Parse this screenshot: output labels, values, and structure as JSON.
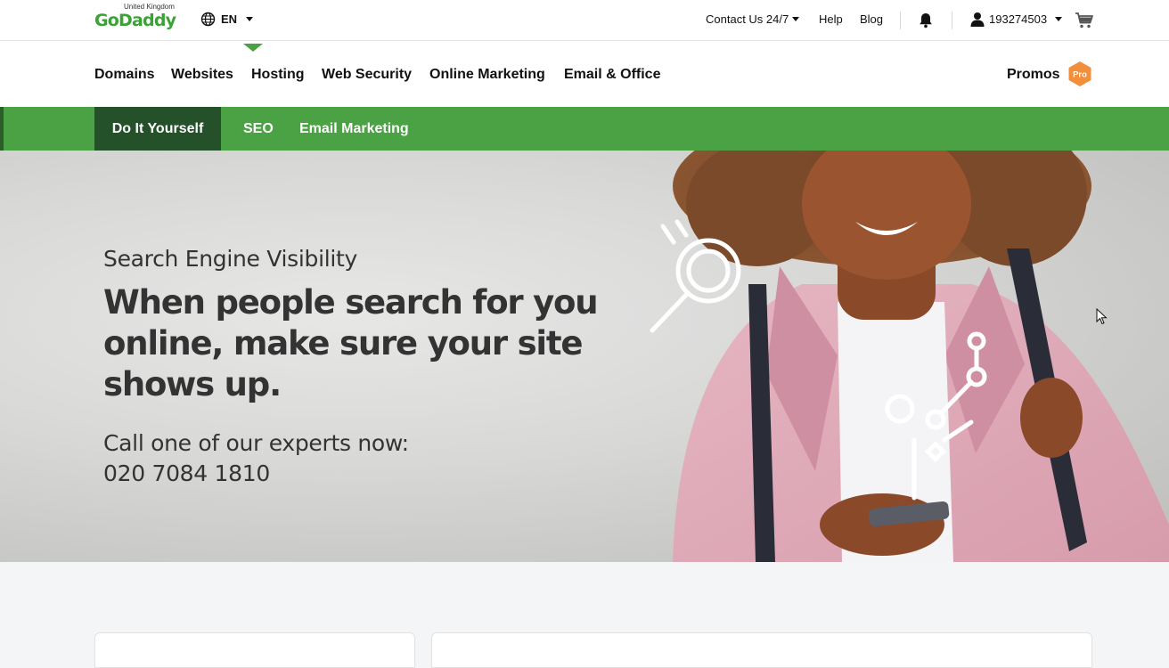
{
  "brand": {
    "name": "GoDaddy",
    "region": "United Kingdom",
    "color": "#3aa335"
  },
  "utility": {
    "language": "EN",
    "contact": "Contact Us 24/7",
    "help": "Help",
    "blog": "Blog",
    "account_id": "193274503",
    "icons": [
      "globe-icon",
      "bell-icon",
      "user-icon",
      "cart-icon"
    ]
  },
  "nav": {
    "items": [
      "Domains",
      "Websites",
      "Hosting",
      "Web Security",
      "Online Marketing",
      "Email & Office"
    ],
    "promos": "Promos",
    "pro_badge": "Pro",
    "pro_color": "#f18f3b"
  },
  "subnav": {
    "active": "Do It Yourself",
    "items": [
      "SEO",
      "Email Marketing"
    ],
    "selected": "SEO",
    "bar_color": "#4ba244",
    "active_color": "#24502a"
  },
  "hero": {
    "kicker": "Search Engine Visibility",
    "title": "When people search for you online, make sure your site shows up.",
    "cta_line": "Call one of our experts now:",
    "phone": "020 7084 1810"
  }
}
